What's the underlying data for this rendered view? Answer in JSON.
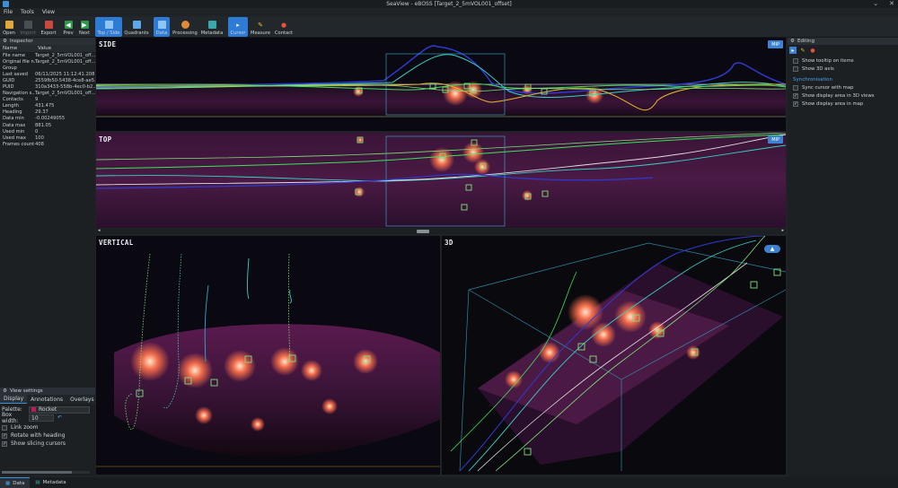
{
  "window": {
    "title": "SeaView - eBOSS [Target_2_5mVOL001_offset]",
    "minimize": "⌄",
    "close": "✕"
  },
  "menu": [
    "File",
    "Tools",
    "View"
  ],
  "toolbar": {
    "open": "Open",
    "import": "Import",
    "export": "Export",
    "prev": "Prev",
    "next": "Next",
    "top_side": "Top / Side",
    "quadrants": "Quadrants",
    "data": "Data",
    "processing": "Processing",
    "metadata": "Metadata",
    "cursor": "Cursor",
    "measure": "Measure",
    "contact": "Contact"
  },
  "inspector": {
    "title": "Inspector",
    "col_name": "Name",
    "col_value": "Value",
    "rows": [
      {
        "k": "File name",
        "v": "Target_2_5mVOL001_off..."
      },
      {
        "k": "Original file n...",
        "v": "Target_2_5mVOL001_off..."
      },
      {
        "k": "Group",
        "v": ""
      },
      {
        "k": "Last saved",
        "v": "06/11/2025 11:12:41.208"
      },
      {
        "k": "GUID",
        "v": "2559fb50-5438-4ce8-ae5..."
      },
      {
        "k": "PUID",
        "v": "310a3433-558b-4ec0-b2..."
      },
      {
        "k": "Navigation s...",
        "v": "Target_2_5mVOL001_off..."
      },
      {
        "k": "Contacts",
        "v": "9"
      },
      {
        "k": "Length",
        "v": "431.475"
      },
      {
        "k": "Heading",
        "v": "29.37"
      },
      {
        "k": "Data min",
        "v": "-0.00249055"
      },
      {
        "k": "Data max",
        "v": "881.05"
      },
      {
        "k": "Used min",
        "v": "0"
      },
      {
        "k": "Used max",
        "v": "100"
      },
      {
        "k": "Frames count",
        "v": "408"
      }
    ]
  },
  "view_settings": {
    "title": "View settings",
    "tabs": [
      "Display",
      "Annotations",
      "Overlays"
    ],
    "palette_label": "Palette:",
    "palette_value": "Rocket",
    "box_width_label": "Box width:",
    "box_width_value": "10",
    "options": [
      {
        "label": "Link zoom",
        "checked": false
      },
      {
        "label": "Rotate with heading",
        "checked": true
      },
      {
        "label": "Show slicing cursors",
        "checked": true
      }
    ]
  },
  "editing": {
    "title": "Editing",
    "options": [
      {
        "label": "Show tooltip on items",
        "checked": false
      },
      {
        "label": "Show 3D axis",
        "checked": false
      }
    ],
    "sync_title": "Synchronisation",
    "sync_options": [
      {
        "label": "Sync cursor with map",
        "checked": false
      },
      {
        "label": "Show display area in 3D views",
        "checked": true
      },
      {
        "label": "Show display area in map",
        "checked": true
      }
    ]
  },
  "views": {
    "side": "SIDE",
    "top": "TOP",
    "vertical": "VERTICAL",
    "three_d": "3D",
    "mip": "MIP"
  },
  "bottom_tabs": [
    "Data",
    "Metadata"
  ],
  "colors": {
    "accent": "#2e7bd6",
    "contact_green": "#7ee07a",
    "track_blue": "#3b4fe0",
    "track_teal": "#38d0c0",
    "track_yellow": "#e7b72a"
  }
}
